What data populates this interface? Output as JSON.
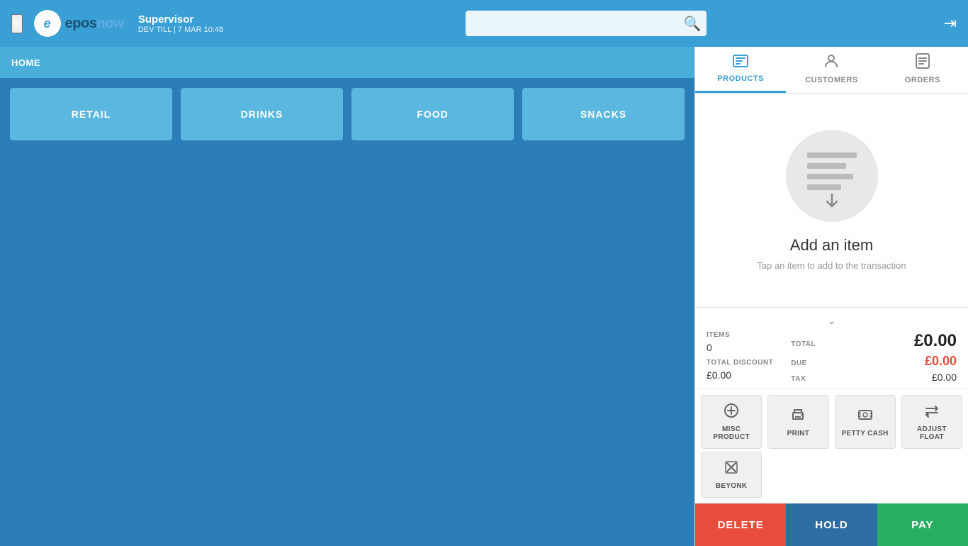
{
  "header": {
    "hamburger": "≡",
    "logo_text_main": "epos",
    "logo_text_brand": "now",
    "supervisor": "Supervisor",
    "till_info": "DEV TILL | 7 MAR 10:48",
    "search_placeholder": ""
  },
  "tabs": [
    {
      "id": "products",
      "label": "PRODUCTS",
      "icon": "🖥",
      "active": true
    },
    {
      "id": "customers",
      "label": "CUSTOMERS",
      "icon": "👤",
      "active": false
    },
    {
      "id": "orders",
      "label": "ORDERS",
      "icon": "📋",
      "active": false
    }
  ],
  "breadcrumb": "HOME",
  "categories": [
    {
      "id": "retail",
      "label": "RETAIL"
    },
    {
      "id": "drinks",
      "label": "DRINKS"
    },
    {
      "id": "food",
      "label": "FOOD"
    },
    {
      "id": "snacks",
      "label": "SNACKS"
    }
  ],
  "add_item": {
    "title": "Add an item",
    "subtitle": "Tap an item to add to the transaction"
  },
  "order_summary": {
    "items_label": "ITEMS",
    "items_value": "0",
    "total_discount_label": "TOTAL DISCOUNT",
    "total_discount_value": "£0.00",
    "total_label": "TOTAL",
    "total_value": "£0.00",
    "due_label": "DUE",
    "due_value": "£0.00",
    "tax_label": "TAX",
    "tax_value": "£0.00"
  },
  "action_buttons": [
    {
      "id": "misc-product",
      "label": "MISC PRODUCT",
      "icon": "⊕"
    },
    {
      "id": "print",
      "label": "PRINT",
      "icon": "🖨"
    },
    {
      "id": "petty-cash",
      "label": "PETTY CASH",
      "icon": "💳"
    },
    {
      "id": "adjust-float",
      "label": "ADJUST FLOAT",
      "icon": "⇄"
    }
  ],
  "action_buttons_row2": [
    {
      "id": "beyonk",
      "label": "BEYONK",
      "icon": "✖"
    }
  ],
  "bottom_buttons": {
    "delete": "DELETE",
    "hold": "HOLD",
    "pay": "PAY"
  }
}
